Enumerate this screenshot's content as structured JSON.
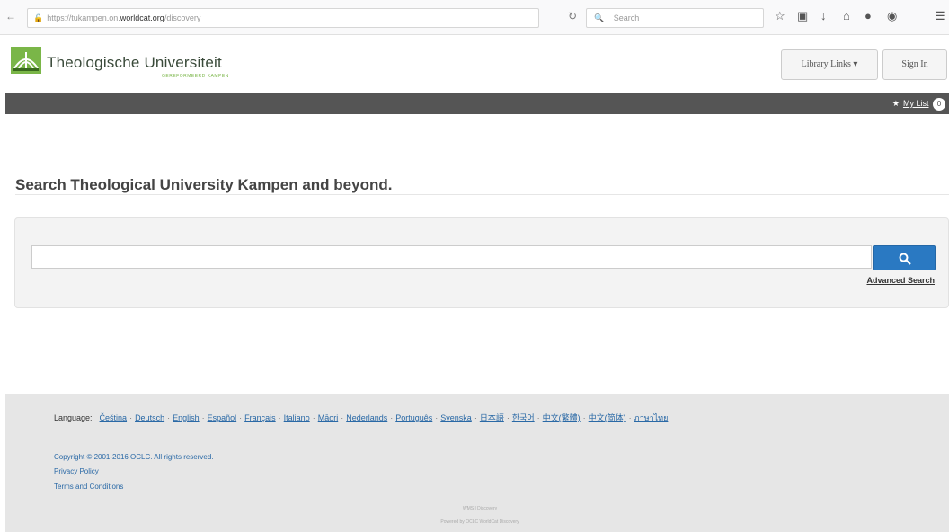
{
  "browser": {
    "url_prefix": "https://tukampen.on.",
    "url_host": "worldcat.org",
    "url_suffix": "/discovery",
    "search_placeholder": "Search"
  },
  "header": {
    "logo_title": "Theologische Universiteit",
    "logo_subtitle": "GEREFORMEERD KAMPEN",
    "library_links_label": "Library Links",
    "sign_in_label": "Sign In"
  },
  "navbar": {
    "mylist_label": "My List",
    "mylist_count": "0"
  },
  "main": {
    "title": "Search Theological University Kampen and beyond.",
    "search_value": "",
    "advanced_search_label": "Advanced Search"
  },
  "footer": {
    "language_label": "Language:",
    "languages": [
      "Čeština",
      "Deutsch",
      "English",
      "Español",
      "Français",
      "Italiano",
      "Māori",
      "Nederlands",
      "Português",
      "Svenska",
      "日本語",
      "한국어",
      "中文(繁體)",
      "中文(简体)",
      "ภาษาไทย"
    ],
    "copyright": "Copyright © 2001-2016 OCLC. All rights reserved.",
    "privacy": "Privacy Policy",
    "terms": "Terms and Conditions",
    "small_1": "WMS | Discovery",
    "small_2": "Powered by OCLC WorldCat Discovery"
  },
  "colors": {
    "accent": "#2a79c2",
    "navbar": "#555555",
    "link": "#2a69a6",
    "logo_green": "#7ab648"
  }
}
